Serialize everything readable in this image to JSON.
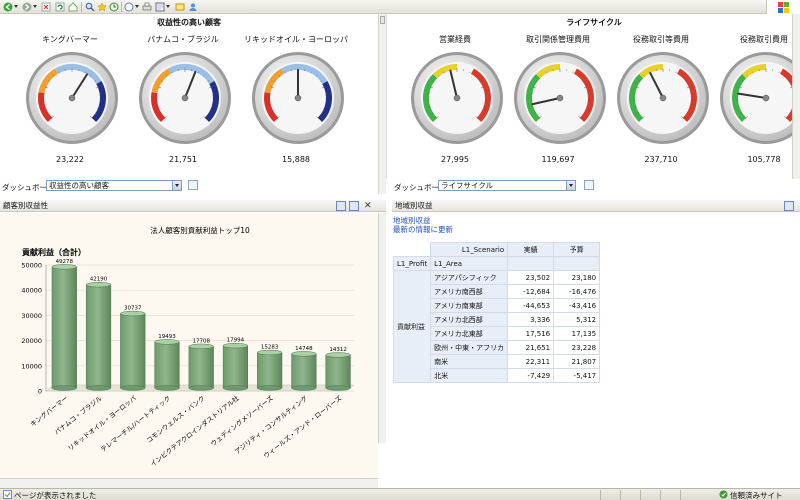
{
  "toolbar": {
    "icons": [
      "back-icon",
      "forward-icon",
      "stop-icon",
      "refresh-icon",
      "home-icon",
      "search-icon",
      "favorites-icon",
      "history-icon",
      "mail-icon",
      "print-icon",
      "edit-icon",
      "discuss-icon",
      "messenger-icon"
    ]
  },
  "left_dashboard": {
    "title": "収益性の高い顧客",
    "gauges": [
      {
        "label": "キングバーマー",
        "value": "23,222",
        "needle": 0.62
      },
      {
        "label": "パナムコ・ブラジル",
        "value": "21,751",
        "needle": 0.58
      },
      {
        "label": "リキッドオイル・ヨーロッパ",
        "value": "15,888",
        "needle": 0.5
      }
    ],
    "dashboard_label": "ダッシュボード:",
    "dashboard_select": "収益性の高い顧客"
  },
  "right_dashboard": {
    "title": "ライフサイクル",
    "gauges": [
      {
        "label": "営業経費",
        "value": "27,995",
        "needle": 0.45
      },
      {
        "label": "取引関係管理費用",
        "value": "119,697",
        "needle": 0.12
      },
      {
        "label": "役務取引等費用",
        "value": "237,710",
        "needle": 0.4
      },
      {
        "label": "役務取引費用",
        "value": "105,778",
        "needle": 0.2
      }
    ],
    "dashboard_label": "ダッシュボード:",
    "dashboard_select": "ライフサイクル"
  },
  "customer_section": {
    "header": "顧客別収益性"
  },
  "region_section": {
    "header": "地域別収益",
    "link1": "地域別収益",
    "link2": "最新の情報に更新",
    "table": {
      "scenario_header": "L1_Scenario",
      "col_actual": "実績",
      "col_budget": "予算",
      "row_header1": "L1_Profit",
      "row_header2": "L1_Area",
      "group_label": "貢献利益",
      "rows": [
        {
          "area": "アジアパシフィック",
          "actual": "23,502",
          "budget": "23,180"
        },
        {
          "area": "アメリカ南西部",
          "actual": "-12,684",
          "budget": "-16,476"
        },
        {
          "area": "アメリカ南東部",
          "actual": "-44,653",
          "budget": "-43,416"
        },
        {
          "area": "アメリカ北西部",
          "actual": "3,336",
          "budget": "5,312"
        },
        {
          "area": "アメリカ北東部",
          "actual": "17,516",
          "budget": "17,135"
        },
        {
          "area": "欧州・中東・アフリカ",
          "actual": "21,651",
          "budget": "23,228"
        },
        {
          "area": "南米",
          "actual": "22,311",
          "budget": "21,807"
        },
        {
          "area": "北米",
          "actual": "-7,429",
          "budget": "-5,417"
        }
      ]
    }
  },
  "statusbar": {
    "left": "ページが表示されました",
    "right": "信頼済みサイト"
  },
  "chart_data": {
    "type": "bar",
    "title": "法人顧客別貢献利益トップ10",
    "ylabel": "貢献利益（合計）",
    "ylim": [
      0,
      50000
    ],
    "yticks": [
      0,
      10000,
      20000,
      30000,
      40000,
      50000
    ],
    "categories": [
      "キングバーマー",
      "パナムコ・ブラジル",
      "リキッドオイル・ヨーロッパ",
      "テレマーチル/ハートティック",
      "コモンウェルス・バンク",
      "インビクテアクロインダストリアル社",
      "ウェディングメソーバーズ",
      "アジリティ・コンサルティング",
      "ウィールズ・アンド・ローバーズ"
    ],
    "values": [
      49278,
      42190,
      30737,
      19493,
      17708,
      17994,
      15283,
      14748,
      14312
    ],
    "data_labels": [
      "49278",
      "42190",
      "30737",
      "19493",
      "17708",
      "17994",
      "15283",
      "14748",
      "14312"
    ],
    "bar_color": "#8fb58c",
    "grid": true
  }
}
